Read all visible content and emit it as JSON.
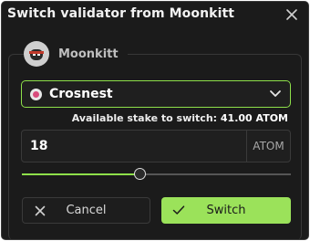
{
  "dialog": {
    "title": "Switch validator from Moonkitt",
    "close_icon": "close-icon"
  },
  "source_validator": {
    "name": "Moonkitt",
    "avatar_icon": "validator-avatar"
  },
  "target_select": {
    "selected": "Crosnest",
    "icon": "validator-logo-icon",
    "chevron_icon": "chevron-down-icon"
  },
  "stake": {
    "available_label": "Available stake to switch:",
    "available_amount": "41.00 ATOM"
  },
  "amount": {
    "value": "18",
    "unit": "ATOM",
    "slider_fraction": 0.44
  },
  "actions": {
    "cancel_label": "Cancel",
    "cancel_icon": "x-icon",
    "switch_label": "Switch",
    "switch_icon": "check-icon"
  },
  "colors": {
    "accent": "#9be25a",
    "background": "#1b1b1b",
    "border": "#3a3a3a"
  }
}
